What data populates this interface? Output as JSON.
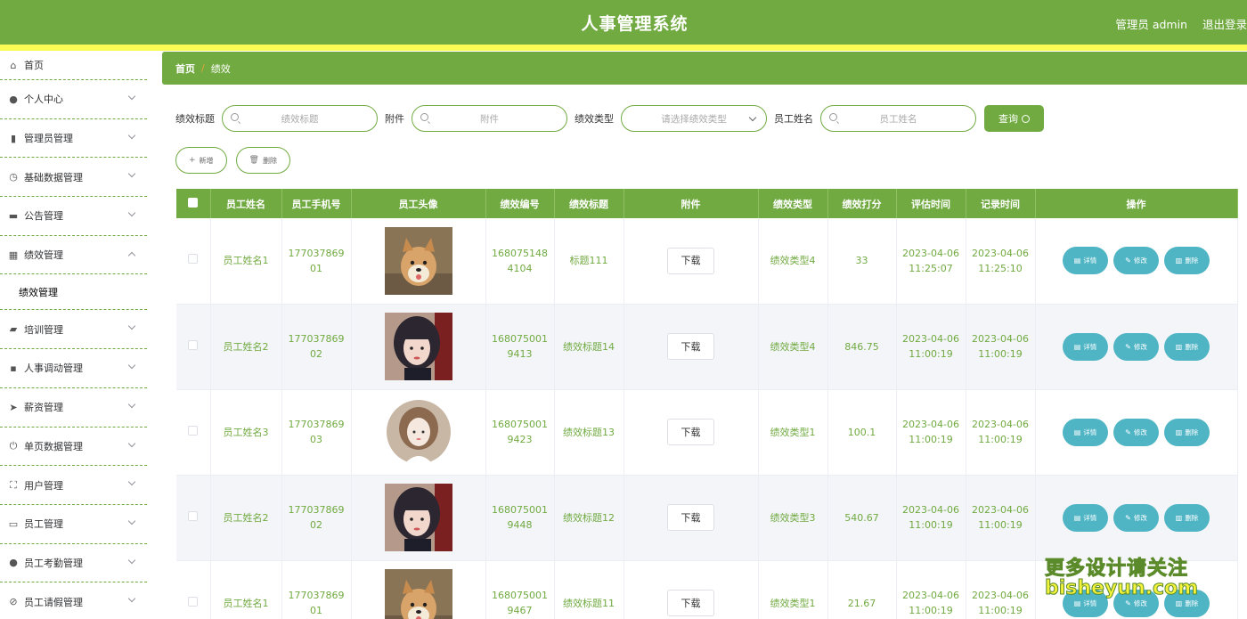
{
  "header": {
    "title": "人事管理系统",
    "user": "管理员 admin",
    "logout": "退出登录"
  },
  "sidebar": {
    "items": [
      {
        "label": "首页",
        "icon": "home-icon",
        "expand": "none"
      },
      {
        "label": "个人中心",
        "icon": "person-icon",
        "expand": "down"
      },
      {
        "label": "管理员管理",
        "icon": "bar-chart-icon",
        "expand": "down"
      },
      {
        "label": "基础数据管理",
        "icon": "clock-icon",
        "expand": "down"
      },
      {
        "label": "公告管理",
        "icon": "printer-icon",
        "expand": "down"
      },
      {
        "label": "绩效管理",
        "icon": "grid-icon",
        "expand": "up"
      },
      {
        "label": "绩效管理",
        "sub": true
      },
      {
        "label": "培训管理",
        "icon": "ticket-icon",
        "expand": "down"
      },
      {
        "label": "人事调动管理",
        "icon": "apps-icon",
        "expand": "down"
      },
      {
        "label": "薪资管理",
        "icon": "send-icon",
        "expand": "down"
      },
      {
        "label": "单页数据管理",
        "icon": "power-icon",
        "expand": "down"
      },
      {
        "label": "用户管理",
        "icon": "fullscreen-icon",
        "expand": "down"
      },
      {
        "label": "员工管理",
        "icon": "briefcase-icon",
        "expand": "down"
      },
      {
        "label": "员工考勤管理",
        "icon": "location-icon",
        "expand": "down"
      },
      {
        "label": "员工请假管理",
        "icon": "compass-icon",
        "expand": "down"
      }
    ]
  },
  "breadcrumb": {
    "home": "首页",
    "separator": "/",
    "current": "绩效"
  },
  "search": {
    "title_label": "绩效标题",
    "title_placeholder": "绩效标题",
    "attach_label": "附件",
    "attach_placeholder": "附件",
    "type_label": "绩效类型",
    "type_placeholder": "请选择绩效类型",
    "name_label": "员工姓名",
    "name_placeholder": "员工姓名",
    "query_button": "查询"
  },
  "actions": {
    "add": "新增",
    "delete": "删除"
  },
  "table": {
    "columns": [
      "员工姓名",
      "员工手机号",
      "员工头像",
      "绩效编号",
      "绩效标题",
      "附件",
      "绩效类型",
      "绩效打分",
      "评估时间",
      "记录时间",
      "操作"
    ],
    "download_label": "下载",
    "op_labels": {
      "detail": "详情",
      "edit": "修改",
      "delete": "删除"
    },
    "rows": [
      {
        "name": "员工姓名1",
        "phone": "17703786901",
        "avatar": "dog",
        "code": "1680751484104",
        "title": "标题111",
        "type": "绩效类型4",
        "score": "33",
        "eval_time": "2023-04-06 11:25:07",
        "record_time": "2023-04-06 11:25:10"
      },
      {
        "name": "员工姓名2",
        "phone": "17703786902",
        "avatar": "girl",
        "code": "1680750019413",
        "title": "绩效标题14",
        "type": "绩效类型4",
        "score": "846.75",
        "eval_time": "2023-04-06 11:00:19",
        "record_time": "2023-04-06 11:00:19"
      },
      {
        "name": "员工姓名3",
        "phone": "17703786903",
        "avatar": "cartoon",
        "code": "1680750019423",
        "title": "绩效标题13",
        "type": "绩效类型1",
        "score": "100.1",
        "eval_time": "2023-04-06 11:00:19",
        "record_time": "2023-04-06 11:00:19"
      },
      {
        "name": "员工姓名2",
        "phone": "17703786902",
        "avatar": "girl",
        "code": "1680750019448",
        "title": "绩效标题12",
        "type": "绩效类型3",
        "score": "540.67",
        "eval_time": "2023-04-06 11:00:19",
        "record_time": "2023-04-06 11:00:19"
      },
      {
        "name": "员工姓名1",
        "phone": "17703786901",
        "avatar": "dog",
        "code": "1680750019467",
        "title": "绩效标题11",
        "type": "绩效类型1",
        "score": "21.67",
        "eval_time": "2023-04-06 11:00:19",
        "record_time": "2023-04-06 11:00:19"
      }
    ]
  },
  "watermark": {
    "line1": "更多设计请关注",
    "line2": "bisheyun.com"
  },
  "colors": {
    "primary": "#71aa41",
    "accent_strip": "#fbfb56",
    "op_button": "#4fb5c4"
  }
}
